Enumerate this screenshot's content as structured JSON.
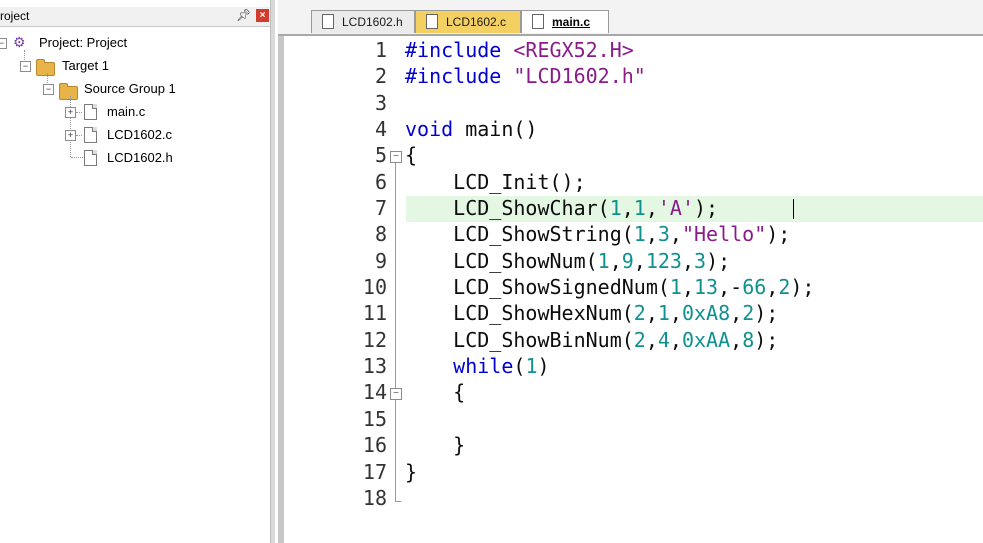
{
  "project_panel": {
    "title": "roject",
    "pin_icon": "pin-icon",
    "close_icon": "close-icon",
    "tree": {
      "project": "Project: Project",
      "target": "Target 1",
      "group": "Source Group 1",
      "files": [
        "main.c",
        "LCD1602.c",
        "LCD1602.h"
      ]
    }
  },
  "tabs": [
    {
      "label": "LCD1602.h"
    },
    {
      "label": "LCD1602.c"
    },
    {
      "label": "main.c"
    }
  ],
  "editor": {
    "line_numbers": [
      "1",
      "2",
      "3",
      "4",
      "5",
      "6",
      "7",
      "8",
      "9",
      "10",
      "11",
      "12",
      "13",
      "14",
      "15",
      "16",
      "17",
      "18"
    ],
    "lines": [
      "#include <REGX52.H>",
      "#include \"LCD1602.h\"",
      "",
      "void main()",
      "{",
      "    LCD_Init();",
      "    LCD_ShowChar(1,1,'A');",
      "    LCD_ShowString(1,3,\"Hello\");",
      "    LCD_ShowNum(1,9,123,3);",
      "    LCD_ShowSignedNum(1,13,-66,2);",
      "    LCD_ShowHexNum(2,1,0xA8,2);",
      "    LCD_ShowBinNum(2,4,0xAA,8);",
      "    while(1)",
      "    {",
      "",
      "    }",
      "}",
      ""
    ],
    "current_line": 7
  },
  "colors": {
    "keyword": "#0000d0",
    "string": "#8a1c8a",
    "number": "#109090",
    "current_line_bg": "#e3f7e3",
    "active_tab_yellow": "#f4cf61"
  }
}
